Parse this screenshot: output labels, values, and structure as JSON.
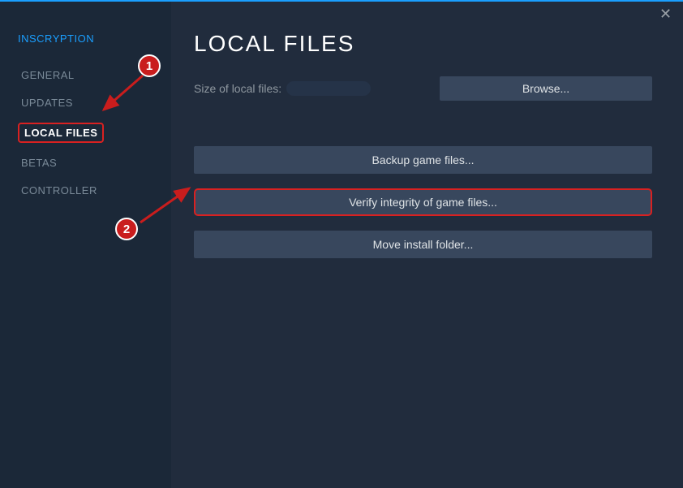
{
  "sidebar": {
    "title": "INSCRYPTION",
    "items": [
      {
        "label": "GENERAL"
      },
      {
        "label": "UPDATES"
      },
      {
        "label": "LOCAL FILES"
      },
      {
        "label": "BETAS"
      },
      {
        "label": "CONTROLLER"
      }
    ]
  },
  "main": {
    "title": "LOCAL FILES",
    "size_label": "Size of local files:",
    "browse_label": "Browse...",
    "backup_label": "Backup game files...",
    "verify_label": "Verify integrity of game files...",
    "move_label": "Move install folder..."
  },
  "annotations": {
    "badge1": "1",
    "badge2": "2"
  }
}
